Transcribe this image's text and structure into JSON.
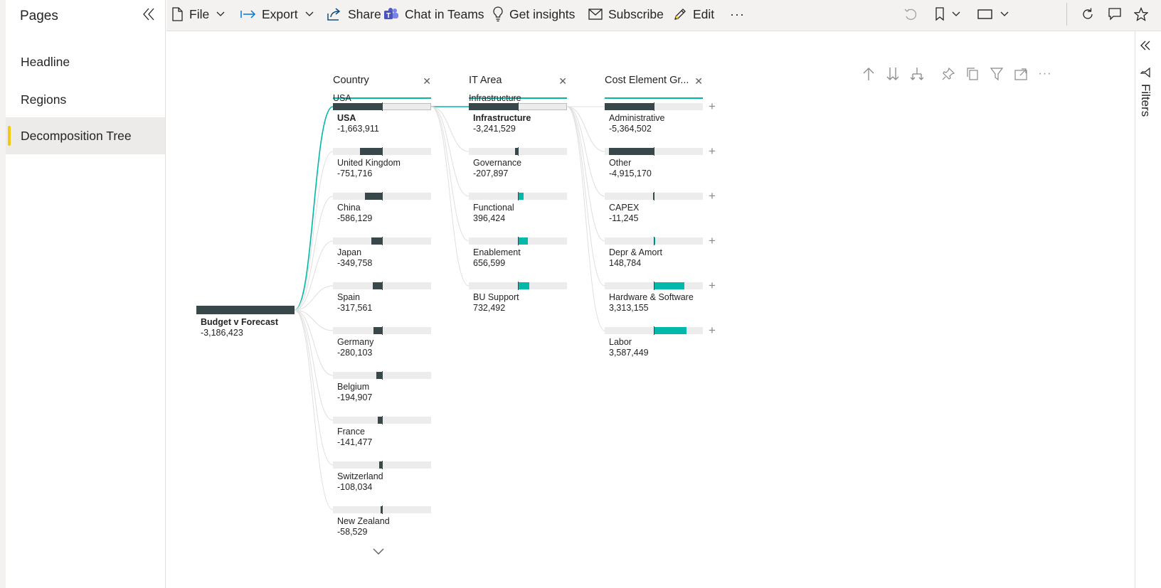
{
  "pages_pane": {
    "title": "Pages",
    "items": [
      {
        "label": "Headline",
        "active": false
      },
      {
        "label": "Regions",
        "active": false
      },
      {
        "label": "Decomposition Tree",
        "active": true
      }
    ]
  },
  "toolbar": {
    "file": "File",
    "export": "Export",
    "share": "Share",
    "chat_in_teams": "Chat in Teams",
    "get_insights": "Get insights",
    "subscribe": "Subscribe",
    "edit": "Edit",
    "more": "···"
  },
  "filters_pane": {
    "label": "Filters"
  },
  "decomposition_tree": {
    "root": {
      "name": "Budget v Forecast",
      "value": "-3,186,423",
      "numeric": -3186423
    },
    "levels": [
      {
        "field": "Country",
        "selected": "USA",
        "items": [
          {
            "name": "USA",
            "value": "-1,663,911",
            "numeric": -1663911,
            "selected": true
          },
          {
            "name": "United Kingdom",
            "value": "-751,716",
            "numeric": -751716
          },
          {
            "name": "China",
            "value": "-586,129",
            "numeric": -586129
          },
          {
            "name": "Japan",
            "value": "-349,758",
            "numeric": -349758
          },
          {
            "name": "Spain",
            "value": "-317,561",
            "numeric": -317561
          },
          {
            "name": "Germany",
            "value": "-280,103",
            "numeric": -280103
          },
          {
            "name": "Belgium",
            "value": "-194,907",
            "numeric": -194907
          },
          {
            "name": "France",
            "value": "-141,477",
            "numeric": -141477
          },
          {
            "name": "Switzerland",
            "value": "-108,034",
            "numeric": -108034
          },
          {
            "name": "New Zealand",
            "value": "-58,529",
            "numeric": -58529
          }
        ]
      },
      {
        "field": "IT Area",
        "selected": "Infrastructure",
        "items": [
          {
            "name": "Infrastructure",
            "value": "-3,241,529",
            "numeric": -3241529,
            "selected": true
          },
          {
            "name": "Governance",
            "value": "-207,897",
            "numeric": -207897
          },
          {
            "name": "Functional",
            "value": "396,424",
            "numeric": 396424
          },
          {
            "name": "Enablement",
            "value": "656,599",
            "numeric": 656599
          },
          {
            "name": "BU Support",
            "value": "732,492",
            "numeric": 732492
          }
        ]
      },
      {
        "field": "Cost Element Gr...",
        "selected": "",
        "items": [
          {
            "name": "Administrative",
            "value": "-5,364,502",
            "numeric": -5364502
          },
          {
            "name": "Other",
            "value": "-4,915,170",
            "numeric": -4915170
          },
          {
            "name": "CAPEX",
            "value": "-11,245",
            "numeric": -11245
          },
          {
            "name": "Depr & Amort",
            "value": "148,784",
            "numeric": 148784
          },
          {
            "name": "Hardware & Software",
            "value": "3,313,155",
            "numeric": 3313155
          },
          {
            "name": "Labor",
            "value": "3,587,449",
            "numeric": 3587449
          }
        ]
      }
    ],
    "colors": {
      "negative": "#37474a",
      "positive": "#01b8aa",
      "track": "#ececec",
      "connector": "#01b8aa"
    }
  }
}
